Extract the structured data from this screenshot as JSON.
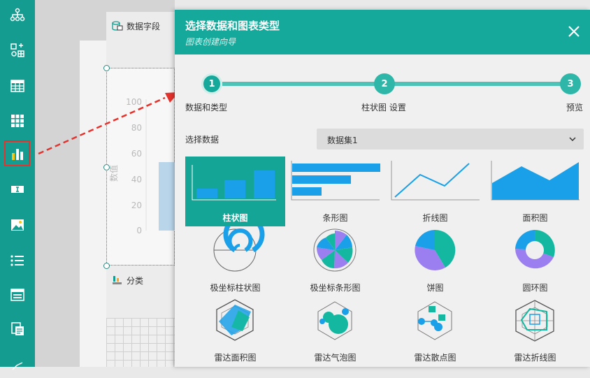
{
  "sidebar": {
    "items": [
      {
        "icon": "tree-structure-icon"
      },
      {
        "icon": "component-add-icon"
      },
      {
        "icon": "table-icon"
      },
      {
        "icon": "grid-table-icon"
      },
      {
        "icon": "bar-chart-icon",
        "selected": true
      },
      {
        "icon": "text-field-icon"
      },
      {
        "icon": "image-icon"
      },
      {
        "icon": "list-icon"
      },
      {
        "icon": "form-icon"
      },
      {
        "icon": "report-icon"
      }
    ],
    "colors": {
      "bg": "#139c8f",
      "highlight_border": "#e5322d"
    }
  },
  "background": {
    "field_panel_title": "数据字段",
    "category_title": "分类",
    "preview_chart": {
      "y_ticks": [
        "100",
        "80",
        "60",
        "40",
        "20",
        "0"
      ],
      "y_label": "数值"
    }
  },
  "dialog": {
    "title": "选择数据和图表类型",
    "subtitle": "图表创建向导",
    "close_icon": "close-icon",
    "accent": "#14a99a",
    "steps": [
      {
        "number": "1",
        "label": "数据和类型",
        "active": true
      },
      {
        "number": "2",
        "label": "柱状图 设置"
      },
      {
        "number": "3",
        "label": "预览"
      }
    ],
    "data_select": {
      "label": "选择数据",
      "value": "数据集1"
    },
    "chart_types": [
      {
        "label": "柱状图",
        "selected": true
      },
      {
        "label": "条形图"
      },
      {
        "label": "折线图"
      },
      {
        "label": "面积图"
      },
      {
        "label": "极坐标柱状图"
      },
      {
        "label": "极坐标条形图"
      },
      {
        "label": "饼图"
      },
      {
        "label": "圆环图"
      },
      {
        "label": "雷达面积图"
      },
      {
        "label": "雷达气泡图"
      },
      {
        "label": "雷达散点图"
      },
      {
        "label": "雷达折线图"
      }
    ]
  }
}
